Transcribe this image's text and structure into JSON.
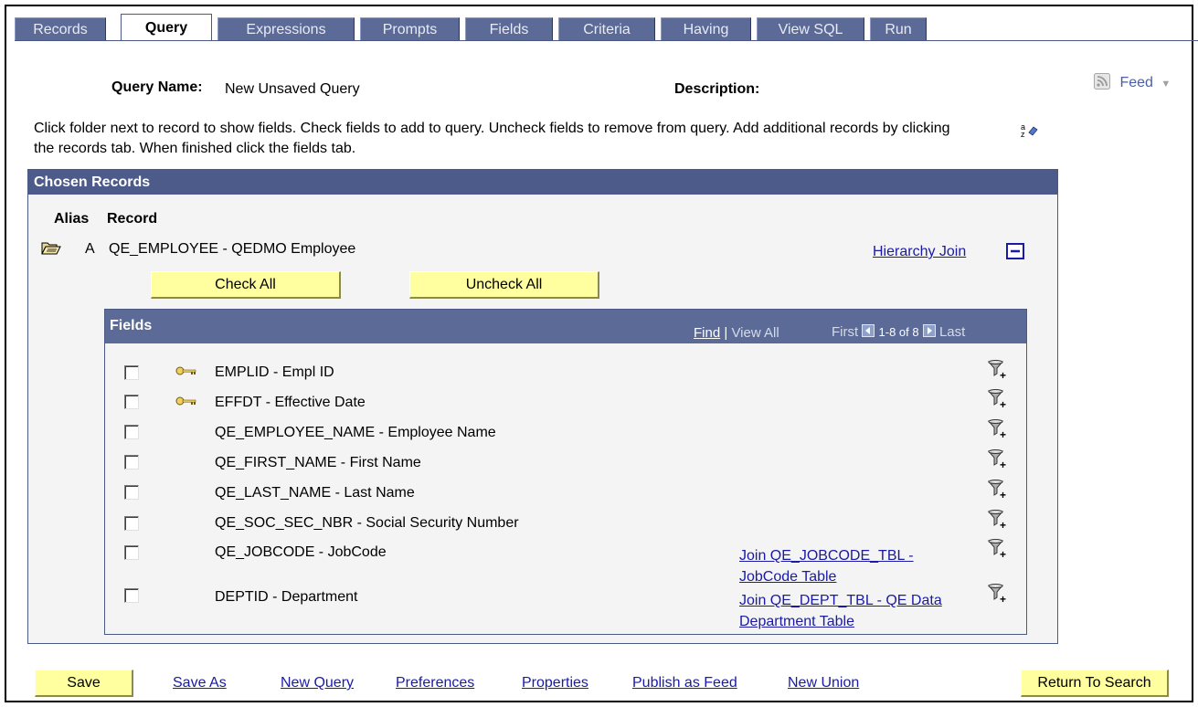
{
  "tabs": [
    "Records",
    "Query",
    "Expressions",
    "Prompts",
    "Fields",
    "Criteria",
    "Having",
    "View SQL",
    "Run"
  ],
  "active_tab": "Query",
  "header": {
    "query_name_label": "Query Name:",
    "query_name_value": "New Unsaved Query",
    "description_label": "Description:",
    "feed_label": "Feed"
  },
  "instructions": "Click folder next to record to show fields. Check fields to add to query. Uncheck fields to remove from query. Add additional records by clicking the records tab. When finished click the fields tab.",
  "chosen_records": {
    "title": "Chosen Records",
    "alias_header": "Alias",
    "record_header": "Record",
    "alias": "A",
    "record": "QE_EMPLOYEE - QEDMO Employee",
    "hierarchy_join": "Hierarchy Join",
    "check_all": "Check All",
    "uncheck_all": "Uncheck All"
  },
  "fields_grid": {
    "title": "Fields",
    "find": "Find",
    "view_all": "View All",
    "first": "First",
    "range": "1-8 of 8",
    "last": "Last",
    "rows": [
      {
        "field": "EMPLID - Empl ID",
        "key": true,
        "join": ""
      },
      {
        "field": "EFFDT - Effective Date",
        "key": true,
        "join": ""
      },
      {
        "field": "QE_EMPLOYEE_NAME - Employee Name",
        "key": false,
        "join": ""
      },
      {
        "field": "QE_FIRST_NAME - First Name",
        "key": false,
        "join": ""
      },
      {
        "field": "QE_LAST_NAME - Last Name",
        "key": false,
        "join": ""
      },
      {
        "field": "QE_SOC_SEC_NBR - Social Security Number",
        "key": false,
        "join": ""
      },
      {
        "field": "QE_JOBCODE - JobCode",
        "key": false,
        "join": "Join QE_JOBCODE_TBL - JobCode Table"
      },
      {
        "field": "DEPTID - Department",
        "key": false,
        "join": "Join QE_DEPT_TBL - QE Data Department Table"
      }
    ]
  },
  "footer": {
    "save": "Save",
    "save_as": "Save As",
    "new_query": "New Query",
    "preferences": "Preferences",
    "properties": "Properties",
    "publish_as_feed": "Publish as Feed",
    "new_union": "New Union",
    "return_to_search": "Return To Search"
  },
  "colors": {
    "tab_bg": "#5b6a96",
    "panel_header": "#4c5b8a",
    "button_bg": "#ffffa0",
    "link": "#1a1aa6"
  }
}
